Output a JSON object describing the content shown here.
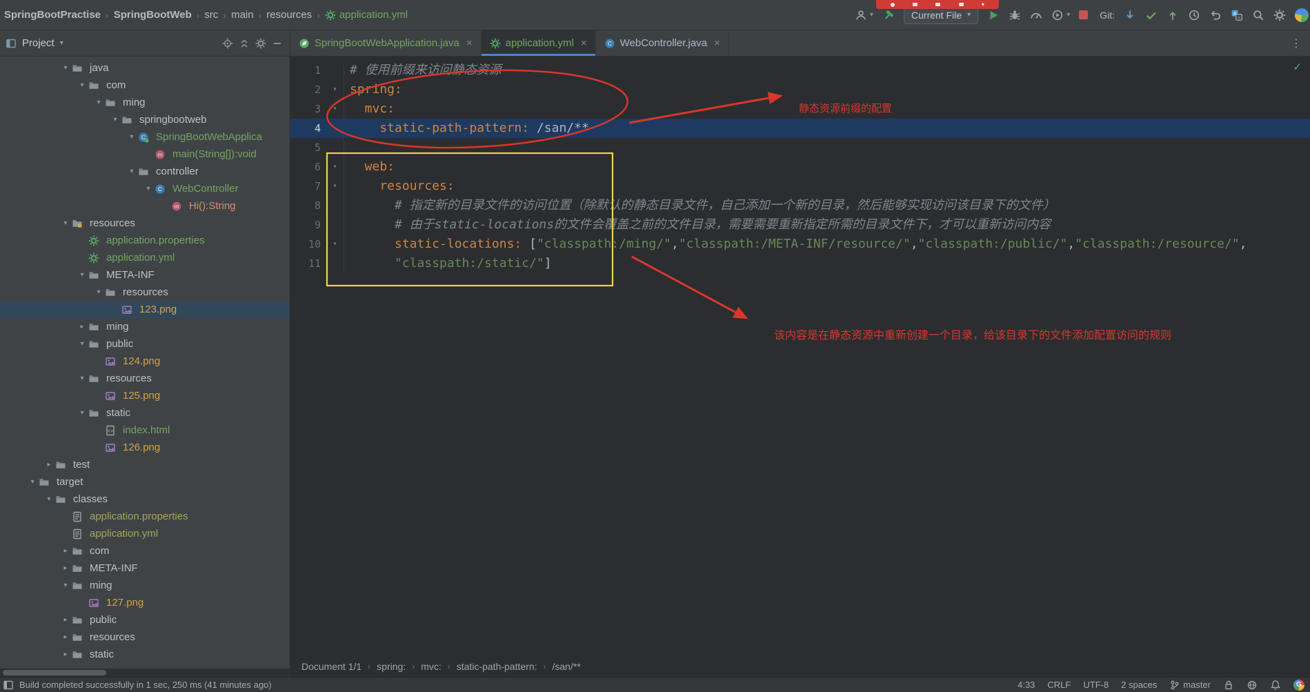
{
  "colors": {
    "accent_blue": "#4a88c7",
    "vcs_green": "#74a564",
    "vcs_orange": "#cfa648",
    "vcs_olive": "#a8a45b",
    "annotation_red": "#d8372c",
    "annotation_yellow": "#ecd64a",
    "yaml_key": "#cf8542",
    "yaml_string": "#6a8759"
  },
  "topbar": {
    "breadcrumbs": [
      {
        "label": "SpringBootPractise",
        "bold": true
      },
      {
        "label": "SpringBootWeb",
        "bold": true
      },
      {
        "label": "src"
      },
      {
        "label": "main"
      },
      {
        "label": "resources"
      },
      {
        "label": "application.yml",
        "icon": "file-spring",
        "green": true
      }
    ],
    "run_config": "Current File",
    "git_label": "Git:"
  },
  "project_panel": {
    "title": "Project",
    "tree": [
      {
        "l": "java",
        "lvl": 3,
        "ch": "v",
        "ic": "folder",
        "c": "dir"
      },
      {
        "l": "com",
        "lvl": 4,
        "ch": "v",
        "ic": "folder",
        "c": "dir"
      },
      {
        "l": "ming",
        "lvl": 5,
        "ch": "v",
        "ic": "folder",
        "c": "dir"
      },
      {
        "l": "springbootweb",
        "lvl": 6,
        "ch": "v",
        "ic": "folder",
        "c": "dir"
      },
      {
        "l": "SpringBootWebApplica",
        "lvl": 7,
        "ch": "v",
        "ic": "class-spring",
        "c": "green"
      },
      {
        "l": "main(String[]):void",
        "lvl": 8,
        "ch": "",
        "ic": "method",
        "c": "green"
      },
      {
        "l": "controller",
        "lvl": 7,
        "ch": "v",
        "ic": "folder",
        "c": "dir"
      },
      {
        "l": "WebController",
        "lvl": 8,
        "ch": "v",
        "ic": "class",
        "c": "green"
      },
      {
        "l": "Hi():String",
        "lvl": 9,
        "ch": "",
        "ic": "method",
        "c": "salmon"
      },
      {
        "l": "resources",
        "lvl": 3,
        "ch": "v",
        "ic": "folder-res",
        "c": "dir"
      },
      {
        "l": "application.properties",
        "lvl": 4,
        "ch": "",
        "ic": "file-spring",
        "c": "green"
      },
      {
        "l": "application.yml",
        "lvl": 4,
        "ch": "",
        "ic": "file-spring",
        "c": "green"
      },
      {
        "l": "META-INF",
        "lvl": 4,
        "ch": "v",
        "ic": "folder",
        "c": "dir"
      },
      {
        "l": "resources",
        "lvl": 5,
        "ch": "v",
        "ic": "folder",
        "c": "dir"
      },
      {
        "l": "123.png",
        "lvl": 6,
        "ch": "",
        "ic": "file-image",
        "c": "orange",
        "sel": true
      },
      {
        "l": "ming",
        "lvl": 4,
        "ch": ">",
        "ic": "folder",
        "c": "dir"
      },
      {
        "l": "public",
        "lvl": 4,
        "ch": "v",
        "ic": "folder",
        "c": "dir"
      },
      {
        "l": "124.png",
        "lvl": 5,
        "ch": "",
        "ic": "file-image",
        "c": "orange"
      },
      {
        "l": "resources",
        "lvl": 4,
        "ch": "v",
        "ic": "folder",
        "c": "dir"
      },
      {
        "l": "125.png",
        "lvl": 5,
        "ch": "",
        "ic": "file-image",
        "c": "orange"
      },
      {
        "l": "static",
        "lvl": 4,
        "ch": "v",
        "ic": "folder",
        "c": "dir"
      },
      {
        "l": "index.html",
        "lvl": 5,
        "ch": "",
        "ic": "file-html",
        "c": "green"
      },
      {
        "l": "126.png",
        "lvl": 5,
        "ch": "",
        "ic": "file-image",
        "c": "orange"
      },
      {
        "l": "test",
        "lvl": 2,
        "ch": ">",
        "ic": "folder",
        "c": "dir"
      },
      {
        "l": "target",
        "lvl": 1,
        "ch": "v",
        "ic": "folder",
        "c": "dir"
      },
      {
        "l": "classes",
        "lvl": 2,
        "ch": "v",
        "ic": "folder",
        "c": "dir"
      },
      {
        "l": "application.properties",
        "lvl": 3,
        "ch": "",
        "ic": "file-prop",
        "c": "olive"
      },
      {
        "l": "application.yml",
        "lvl": 3,
        "ch": "",
        "ic": "file-prop",
        "c": "olive"
      },
      {
        "l": "com",
        "lvl": 3,
        "ch": ">",
        "ic": "folder",
        "c": "dir"
      },
      {
        "l": "META-INF",
        "lvl": 3,
        "ch": ">",
        "ic": "folder",
        "c": "dir"
      },
      {
        "l": "ming",
        "lvl": 3,
        "ch": "v",
        "ic": "folder",
        "c": "dir"
      },
      {
        "l": "127.png",
        "lvl": 4,
        "ch": "",
        "ic": "file-image",
        "c": "orange"
      },
      {
        "l": "public",
        "lvl": 3,
        "ch": ">",
        "ic": "folder",
        "c": "dir"
      },
      {
        "l": "resources",
        "lvl": 3,
        "ch": ">",
        "ic": "folder",
        "c": "dir"
      },
      {
        "l": "static",
        "lvl": 3,
        "ch": ">",
        "ic": "folder",
        "c": "dir"
      }
    ]
  },
  "tabs": [
    {
      "label": "SpringBootWebApplication.java",
      "icon": "spring-boot",
      "color": "#74a564",
      "active": false
    },
    {
      "label": "application.yml",
      "icon": "file-spring",
      "color": "#74a564",
      "active": true
    },
    {
      "label": "WebController.java",
      "icon": "class",
      "color": "#a9b7c6",
      "active": false
    }
  ],
  "editor": {
    "lines": [
      {
        "n": 1,
        "tokens": [
          {
            "t": "# 使用前缀来访问静态资源",
            "s": "com"
          }
        ]
      },
      {
        "n": 2,
        "fold": true,
        "tokens": [
          {
            "t": "spring:",
            "s": "key"
          }
        ]
      },
      {
        "n": 3,
        "fold": true,
        "tokens": [
          {
            "t": "  mvc:",
            "s": "key"
          }
        ]
      },
      {
        "n": 4,
        "active": true,
        "tokens": [
          {
            "t": "    static-path-pattern:",
            "s": "key"
          },
          {
            "t": " /san/**",
            "s": "val"
          }
        ]
      },
      {
        "n": 5,
        "tokens": []
      },
      {
        "n": 6,
        "fold": true,
        "tokens": [
          {
            "t": "  web:",
            "s": "key"
          }
        ]
      },
      {
        "n": 7,
        "fold": true,
        "tokens": [
          {
            "t": "    resources:",
            "s": "key"
          }
        ]
      },
      {
        "n": 8,
        "tokens": [
          {
            "t": "      # 指定新的目录文件的访问位置（除默认的静态目录文件，自己添加一个新的目录，然后能够实现访问该目录下的文件）",
            "s": "com"
          }
        ]
      },
      {
        "n": 9,
        "tokens": [
          {
            "t": "      # 由于static-locations的文件会覆盖之前的文件目录，需要需要重新指定所需的目录文件下，才可以重新访问内容",
            "s": "com"
          }
        ]
      },
      {
        "n": 10,
        "fold": true,
        "tokens": [
          {
            "t": "      static-locations:",
            "s": "key"
          },
          {
            "t": " [",
            "s": "val"
          },
          {
            "t": "\"classpath:/ming/\"",
            "s": "str"
          },
          {
            "t": ",",
            "s": "val"
          },
          {
            "t": "\"classpath:/META-INF/resource/\"",
            "s": "str"
          },
          {
            "t": ",",
            "s": "val"
          },
          {
            "t": "\"classpath:/public/\"",
            "s": "str"
          },
          {
            "t": ",",
            "s": "val"
          },
          {
            "t": "\"classpath:/resource/\"",
            "s": "str"
          },
          {
            "t": ",",
            "s": "val"
          }
        ]
      },
      {
        "n": 11,
        "tokens": [
          {
            "t": "      ",
            "s": "val"
          },
          {
            "t": "\"classpath:/static/\"",
            "s": "str"
          },
          {
            "t": "]",
            "s": "val"
          }
        ]
      }
    ],
    "breadcrumbs": [
      "Document 1/1",
      "spring:",
      "mvc:",
      "static-path-pattern:",
      "/san/**"
    ]
  },
  "annotations": {
    "label_top": "静态资源前缀的配置",
    "label_bottom": "该内容是在静态资源中重新创建一个目录，给该目录下的文件添加配置访问的规则"
  },
  "statusbar": {
    "message": "Build completed successfully in 1 sec, 250 ms (41 minutes ago)",
    "caret": "4:33",
    "line_ending": "CRLF",
    "encoding": "UTF-8",
    "indent": "2 spaces",
    "branch": "master"
  }
}
